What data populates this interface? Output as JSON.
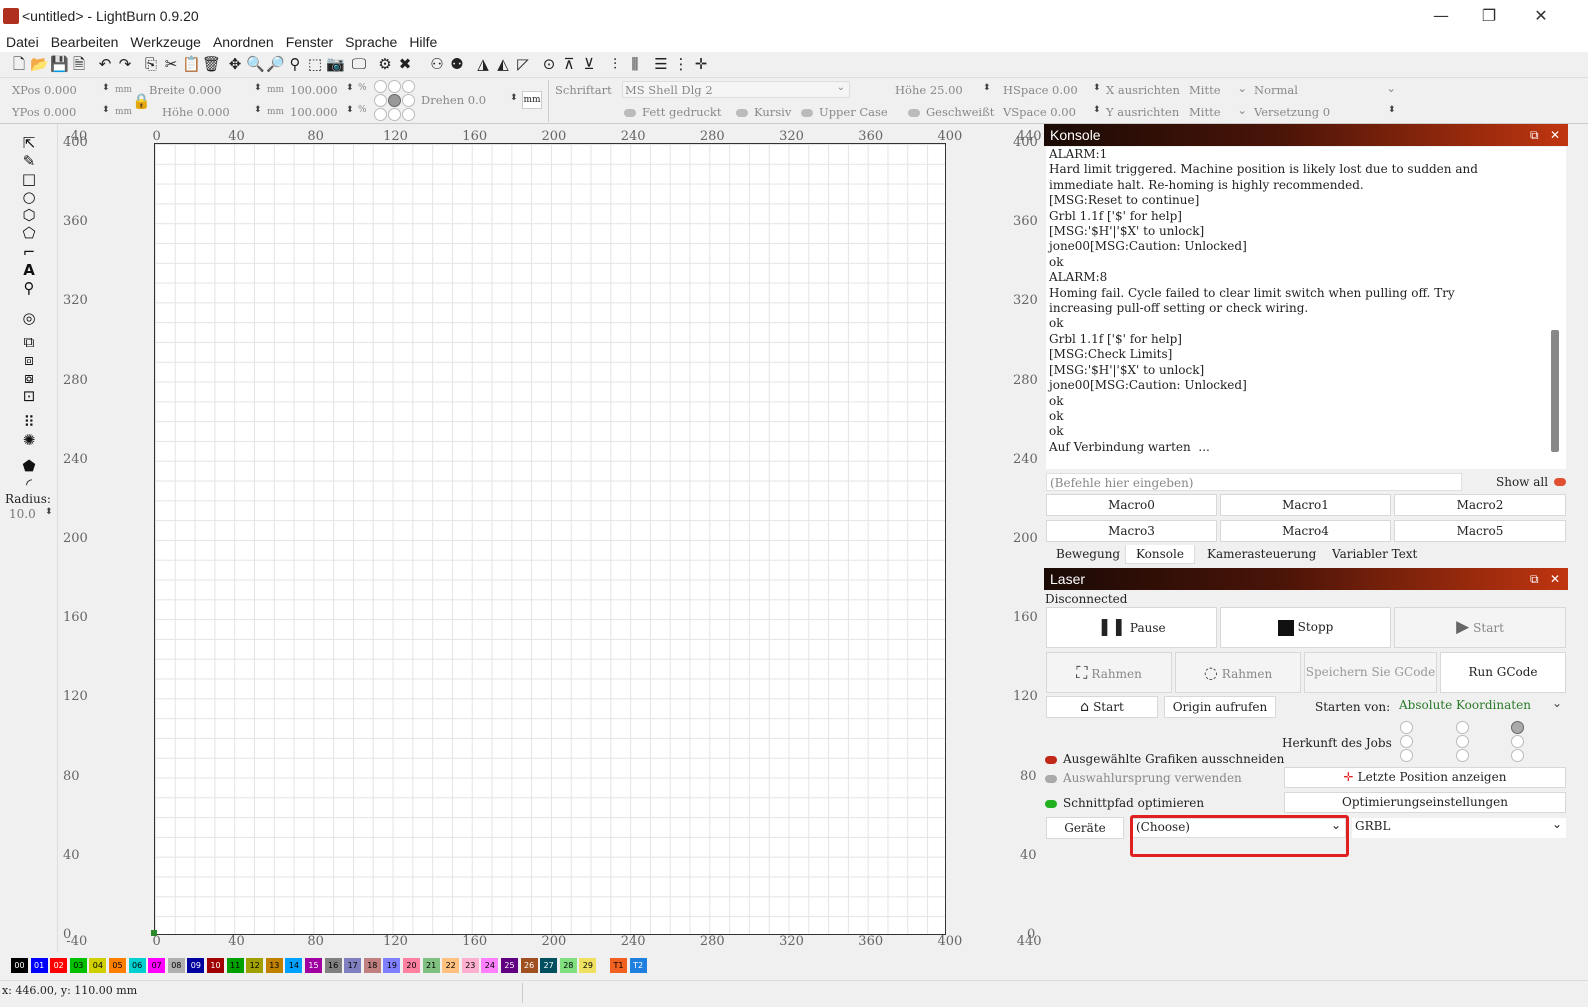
{
  "window": {
    "title": "<untitled> - LightBurn 0.9.20",
    "minimize": "—",
    "maximize": "❐",
    "close": "✕"
  },
  "menu": [
    "Datei",
    "Bearbeiten",
    "Werkzeuge",
    "Anordnen",
    "Fenster",
    "Sprache",
    "Hilfe"
  ],
  "props": {
    "xpos": "XPos 0.000",
    "ypos": "YPos 0.000",
    "unit": "mm",
    "breite": "Breite 0.000",
    "hoehe": "Höhe 0.000",
    "pct": "100.000",
    "pct_sign": "%",
    "drehen": "Drehen 0.0",
    "schriftart_label": "Schriftart",
    "schriftart": "MS Shell Dlg 2",
    "font_hoehe": "Höhe 25.00",
    "hspace": "HSpace 0.00",
    "vspace": "VSpace 0.00",
    "x_ausrichten": "X ausrichten",
    "y_ausrichten": "Y ausrichten",
    "mitte": "Mitte",
    "normal": "Normal",
    "versetzung": "Versetzung 0",
    "fett": "Fett gedruckt",
    "kursiv": "Kursiv",
    "upper": "Upper Case",
    "geschweisst": "Geschweißt"
  },
  "radius": {
    "label": "Radius:",
    "value": "10.0"
  },
  "ruler": {
    "top": [
      "-40",
      "0",
      "40",
      "80",
      "120",
      "160",
      "200",
      "240",
      "280",
      "320",
      "360",
      "400",
      "440"
    ],
    "left": [
      "400",
      "360",
      "320",
      "280",
      "240",
      "200",
      "160",
      "120",
      "80",
      "40",
      "0"
    ]
  },
  "console": {
    "title": "Konsole",
    "lines": [
      "ALARM:1",
      "Hard limit triggered. Machine position is likely lost due to sudden and",
      "immediate halt. Re-homing is highly recommended.",
      "[MSG:Reset to continue]",
      "Grbl 1.1f ['$' for help]",
      "[MSG:'$H'|'$X' to unlock]",
      "jone00[MSG:Caution: Unlocked]",
      "ok",
      "ALARM:8",
      "Homing fail. Cycle failed to clear limit switch when pulling off. Try",
      "increasing pull-off setting or check wiring.",
      "ok",
      "Grbl 1.1f ['$' for help]",
      "[MSG:Check Limits]",
      "[MSG:'$H'|'$X' to unlock]",
      "jone00[MSG:Caution: Unlocked]",
      "ok",
      "ok",
      "ok",
      "Auf Verbindung warten  ..."
    ],
    "input_placeholder": "(Befehle hier eingeben)",
    "show_all": "Show all",
    "macros": [
      "Macro0",
      "Macro1",
      "Macro2",
      "Macro3",
      "Macro4",
      "Macro5"
    ],
    "tabs": [
      "Bewegung",
      "Konsole",
      "Kamerasteuerung",
      "Variabler Text"
    ]
  },
  "laser": {
    "title": "Laser",
    "status": "Disconnected",
    "pause": "Pause",
    "stopp": "Stopp",
    "start": "Start",
    "rahmen1": "Rahmen",
    "rahmen2": "Rahmen",
    "save_gcode": "Speichern Sie GCode",
    "run_gcode": "Run GCode",
    "home": "Start",
    "origin": "Origin aufrufen",
    "starten_von": "Starten von:",
    "starten_value": "Absolute Koordinaten",
    "herkunft": "Herkunft des Jobs",
    "cut_selected": "Ausgewählte Grafiken ausschneiden",
    "use_selection_origin": "Auswahlursprung verwenden",
    "last_pos": "Letzte Position anzeigen",
    "optimize": "Schnittpfad optimieren",
    "opt_settings": "Optimierungseinstellungen",
    "geraete": "Geräte",
    "choose": "(Choose)",
    "grbl": "GRBL"
  },
  "palette": [
    {
      "l": "00",
      "c": "#000000",
      "t": "#fff"
    },
    {
      "l": "01",
      "c": "#0000ff",
      "t": "#fff"
    },
    {
      "l": "02",
      "c": "#ff0000",
      "t": "#fff"
    },
    {
      "l": "03",
      "c": "#00c000",
      "t": "#000"
    },
    {
      "l": "04",
      "c": "#d0d000",
      "t": "#000"
    },
    {
      "l": "05",
      "c": "#ff8000",
      "t": "#000"
    },
    {
      "l": "06",
      "c": "#00d0d0",
      "t": "#000"
    },
    {
      "l": "07",
      "c": "#ff00ff",
      "t": "#000"
    },
    {
      "l": "08",
      "c": "#b0b0b0",
      "t": "#000"
    },
    {
      "l": "09",
      "c": "#0000a0",
      "t": "#fff"
    },
    {
      "l": "10",
      "c": "#a00000",
      "t": "#fff"
    },
    {
      "l": "11",
      "c": "#00a000",
      "t": "#000"
    },
    {
      "l": "12",
      "c": "#a0a000",
      "t": "#000"
    },
    {
      "l": "13",
      "c": "#c08000",
      "t": "#000"
    },
    {
      "l": "14",
      "c": "#00a0ff",
      "t": "#000"
    },
    {
      "l": "15",
      "c": "#a000a0",
      "t": "#fff"
    },
    {
      "l": "16",
      "c": "#808080",
      "t": "#000"
    },
    {
      "l": "17",
      "c": "#8080c0",
      "t": "#000"
    },
    {
      "l": "18",
      "c": "#c08080",
      "t": "#000"
    },
    {
      "l": "19",
      "c": "#8080ff",
      "t": "#000"
    },
    {
      "l": "20",
      "c": "#ff80a0",
      "t": "#000"
    },
    {
      "l": "21",
      "c": "#80c080",
      "t": "#000"
    },
    {
      "l": "22",
      "c": "#ffc080",
      "t": "#000"
    },
    {
      "l": "23",
      "c": "#ffb0d0",
      "t": "#000"
    },
    {
      "l": "24",
      "c": "#ff80ff",
      "t": "#000"
    },
    {
      "l": "25",
      "c": "#600080",
      "t": "#fff"
    },
    {
      "l": "26",
      "c": "#a05020",
      "t": "#fff"
    },
    {
      "l": "27",
      "c": "#005060",
      "t": "#fff"
    },
    {
      "l": "28",
      "c": "#80e080",
      "t": "#000"
    },
    {
      "l": "29",
      "c": "#f0e060",
      "t": "#000"
    },
    {
      "l": "T1",
      "c": "#f06020",
      "t": "#000"
    },
    {
      "l": "T2",
      "c": "#2080e0",
      "t": "#fff"
    }
  ],
  "statusbar": {
    "coords": "x: 446.00, y: 110.00 mm"
  },
  "colors": {
    "highlight": "#e02020",
    "accent_green": "#20b020"
  }
}
